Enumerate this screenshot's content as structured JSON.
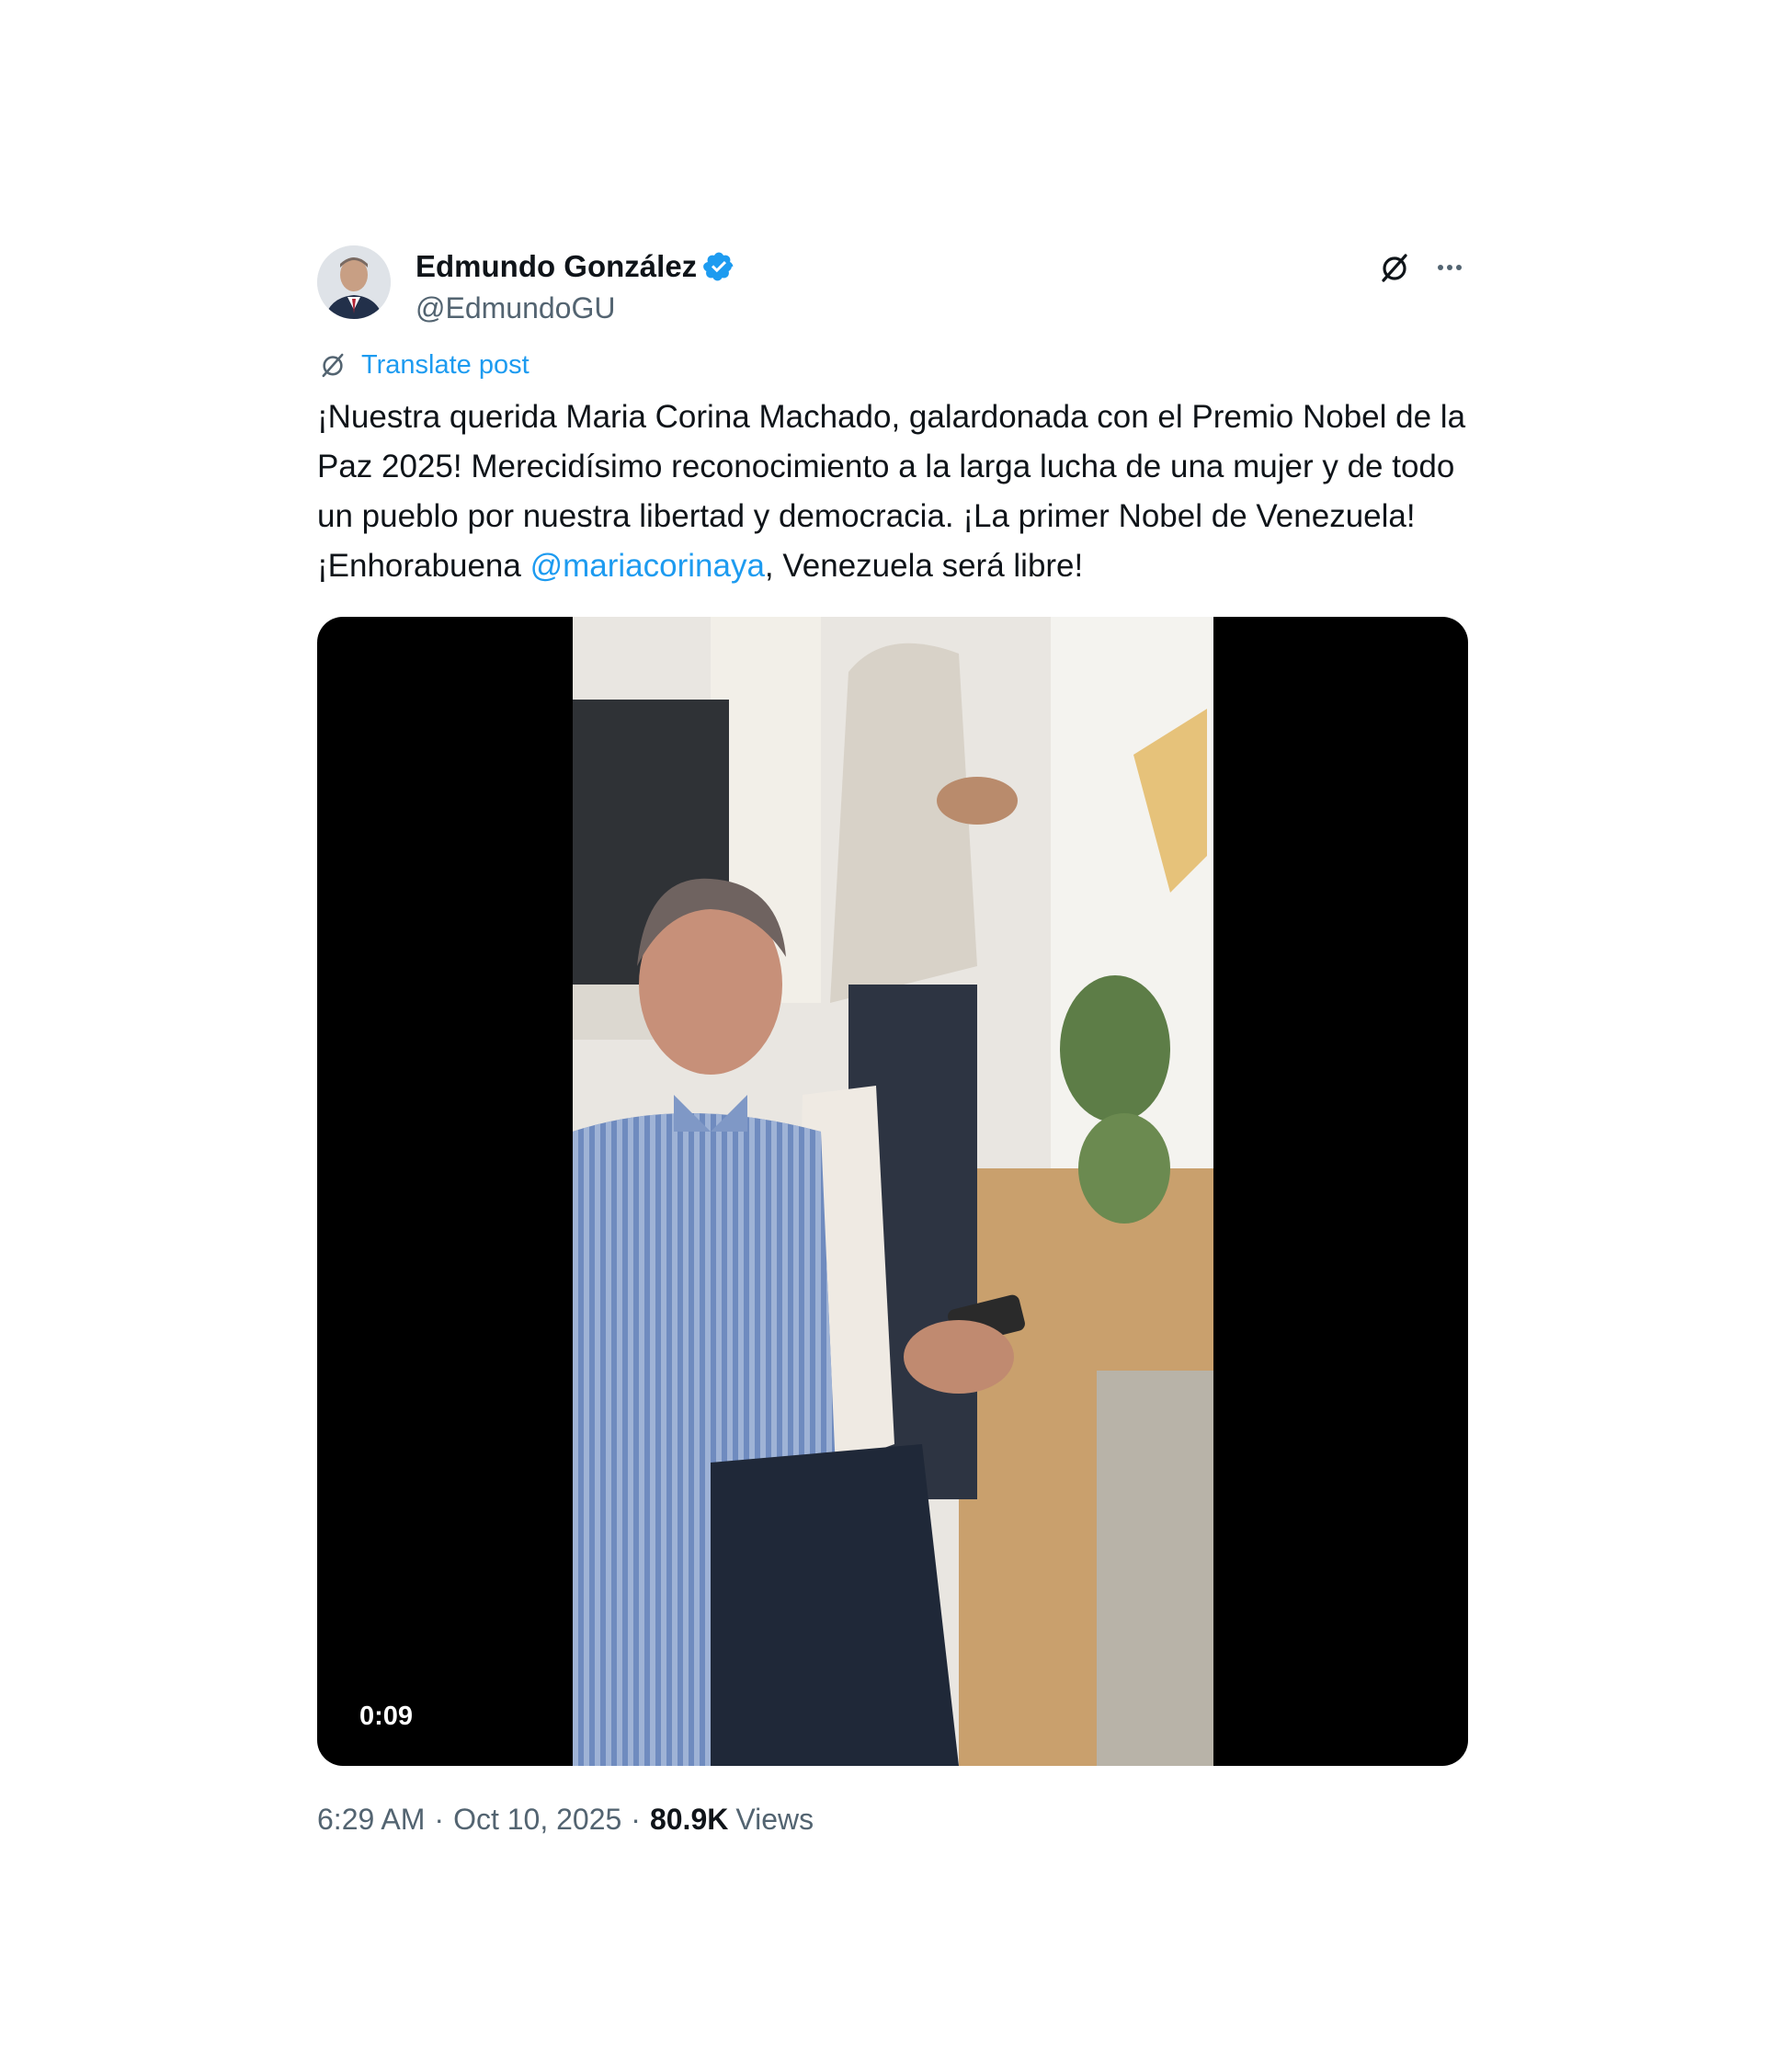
{
  "author": {
    "display_name": "Edmundo González",
    "handle": "@EdmundoGU",
    "avatar_icon": "profile-photo",
    "verified_icon": "verified-badge-icon",
    "verified_color": "#1d9bf0"
  },
  "header_actions": {
    "grok_icon": "grok-icon",
    "more_icon": "more-options-icon"
  },
  "translate": {
    "icon": "grok-icon",
    "label": "Translate post"
  },
  "post": {
    "text_before_mention": "¡Nuestra querida Maria Corina Machado, galardonada con el Premio Nobel de la Paz 2025! Merecidísimo reconocimiento a la larga lucha de una mujer y de todo un pueblo por nuestra libertad y democracia. ¡La primer Nobel de Venezuela! ¡Enhorabuena ",
    "mention": "@mariacorinaya",
    "text_after_mention": ", Venezuela será libre!"
  },
  "media": {
    "type": "video",
    "duration": "0:09"
  },
  "meta": {
    "time": "6:29 AM",
    "separator": "·",
    "date": "Oct 10, 2025",
    "views_count": "80.9K",
    "views_label": "Views"
  },
  "colors": {
    "accent": "#1d9bf0",
    "text_primary": "#0f1419",
    "text_secondary": "#536471"
  }
}
